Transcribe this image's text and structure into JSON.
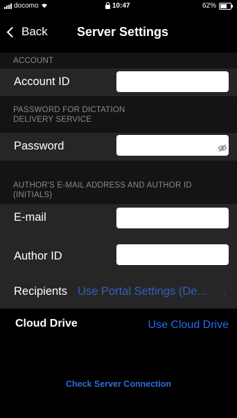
{
  "status_bar": {
    "carrier": "docomo",
    "time": "10:47",
    "battery_percent": "62%",
    "battery_level": 0.62,
    "signal_icon": "signal-bars-icon",
    "wifi_icon": "wifi-icon",
    "lock_icon": "orientation-lock-icon",
    "battery_icon": "battery-icon"
  },
  "nav": {
    "back_label": "Back",
    "title": "Server Settings",
    "back_icon": "chevron-left-icon"
  },
  "sections": {
    "account_header": "ACCOUNT",
    "password_header_line1": "PASSWORD FOR DICTATION",
    "password_header_line2": "DELIVERY SERVICE",
    "author_header_line1": "AUTHOR'S E-MAIL ADDRESS AND AUTHOR ID",
    "author_header_line2": "(INITIALS)"
  },
  "fields": {
    "account_id_label": "Account ID",
    "account_id_value": "",
    "password_label": "Password",
    "password_value": "",
    "password_visibility_icon": "eye-slash-icon",
    "email_label": "E-mail",
    "email_value": "",
    "author_id_label": "Author ID",
    "author_id_value": ""
  },
  "recipients": {
    "label": "Recipients",
    "value": "Use Portal Settings (De...",
    "chevron_icon": "chevron-right-icon"
  },
  "cloud_drive": {
    "label": "Cloud Drive",
    "link": "Use Cloud Drive"
  },
  "actions": {
    "check_connection": "Check Server Connection"
  },
  "colors": {
    "background": "#000000",
    "section_header_bg": "#141414",
    "row_bg": "#262626",
    "accent_blue": "#1f6ff0",
    "muted_blue": "#2f62b8",
    "header_text": "#8a8a8a"
  }
}
